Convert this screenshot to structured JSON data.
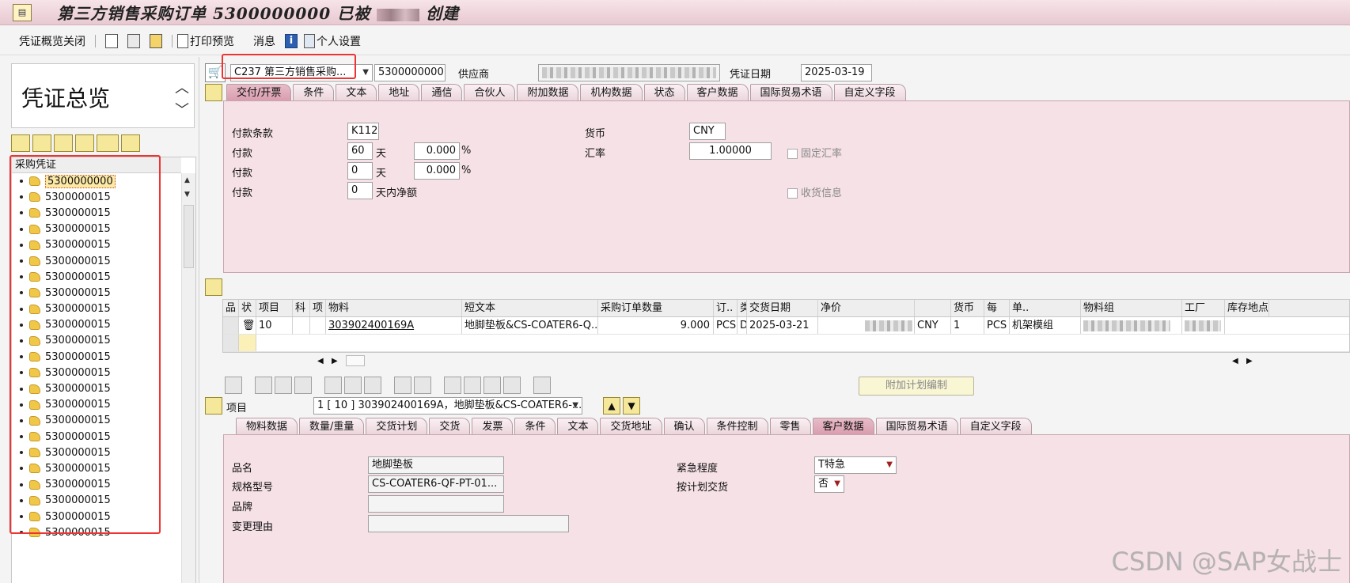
{
  "titlebar": {
    "title_prefix": "第三方销售采购订单",
    "po_number": "5300000000",
    "title_middle": "已被",
    "title_suffix": "创建"
  },
  "toolbar": {
    "overview_close": "凭证概览关闭",
    "print_preview": "打印预览",
    "messages": "消息",
    "personal_settings": "个人设置"
  },
  "left": {
    "overview_title": "凭证总览",
    "tree_header": "采购凭证",
    "tree_items": [
      "5300000000",
      "5300000015",
      "5300000015",
      "5300000015",
      "5300000015",
      "5300000015",
      "5300000015",
      "5300000015",
      "5300000015",
      "5300000015",
      "5300000015",
      "5300000015",
      "5300000015",
      "5300000015",
      "5300000015",
      "5300000015",
      "5300000015",
      "5300000015",
      "5300000015",
      "5300000015",
      "5300000015",
      "5300000015",
      "5300000015"
    ]
  },
  "header": {
    "doc_type": "C237 第三方销售采购...",
    "po_number": "5300000000",
    "vendor_label": "供应商",
    "doc_date_label": "凭证日期",
    "doc_date": "2025-03-19",
    "tabs": [
      "交付/开票",
      "条件",
      "文本",
      "地址",
      "通信",
      "合伙人",
      "附加数据",
      "机构数据",
      "状态",
      "客户数据",
      "国际贸易术语",
      "自定义字段"
    ],
    "active_tab": 0,
    "payment_terms_label": "付款条款",
    "payment_terms": "K112",
    "payment_label": "付款",
    "payment1_days": "60",
    "payment1_pct": "0.000",
    "payment2_days": "0",
    "payment2_pct": "0.000",
    "payment3_days": "0",
    "days_unit": "天",
    "net_days_unit": "天内净额",
    "pct_unit": "%",
    "currency_label": "货币",
    "currency": "CNY",
    "exchange_label": "汇率",
    "exchange_rate": "1.00000",
    "fixed_rate_label": "固定汇率",
    "gr_message_label": "收货信息"
  },
  "items_grid": {
    "columns": [
      "品",
      "状",
      "项目",
      "科",
      "项",
      "物料",
      "短文本",
      "采购订单数量",
      "订..",
      "类",
      "交货日期",
      "净价",
      "",
      "货币",
      "每",
      "单..",
      "物料组",
      "工厂",
      "库存地点"
    ],
    "row": {
      "item": "10",
      "material": "303902400169A",
      "short_text": "地脚垫板&CS-COATER6-Q...",
      "qty": "9.000",
      "unit": "PCS",
      "d": "D",
      "delivery_date": "2025-03-21",
      "currency": "CNY",
      "per": "1",
      "order_unit": "PCS",
      "material_group": "机架模组"
    }
  },
  "item_detail": {
    "add_schedule_button": "附加计划编制",
    "item_label": "项目",
    "item_select": "1 [ 10 ] 303902400169A，地脚垫板&CS-COATER6-...",
    "tabs": [
      "物料数据",
      "数量/重量",
      "交货计划",
      "交货",
      "发票",
      "条件",
      "文本",
      "交货地址",
      "确认",
      "条件控制",
      "零售",
      "客户数据",
      "国际贸易术语",
      "自定义字段"
    ],
    "active_tab": 11,
    "product_name_label": "品名",
    "product_name": "地脚垫板",
    "spec_label": "规格型号",
    "spec": "CS-COATER6-QF-PT-01...",
    "brand_label": "品牌",
    "change_reason_label": "变更理由",
    "urgency_label": "紧急程度",
    "urgency": "T特急",
    "scheduled_delivery_label": "按计划交货",
    "scheduled_delivery": "否"
  },
  "watermark": "CSDN @SAP女战士"
}
